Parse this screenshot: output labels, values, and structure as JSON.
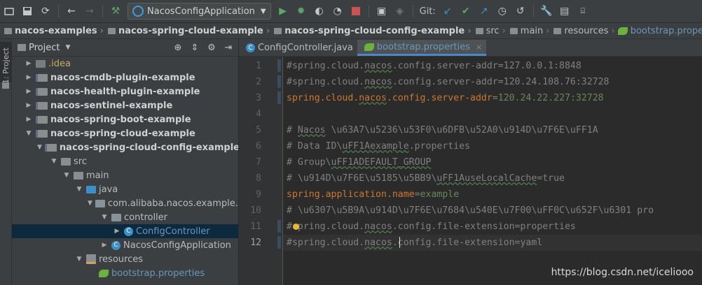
{
  "toolbar": {
    "run_config": "NacosConfigApplication",
    "git_label": "Git:"
  },
  "breadcrumb": [
    {
      "label": "nacos-examples",
      "style": "bold"
    },
    {
      "label": "nacos-spring-cloud-example",
      "style": "bold"
    },
    {
      "label": "nacos-spring-cloud-config-example",
      "style": "bold"
    },
    {
      "label": "src",
      "style": "light"
    },
    {
      "label": "main",
      "style": "light"
    },
    {
      "label": "resources",
      "style": "light"
    },
    {
      "label": "bootstrap.properties",
      "style": "file"
    }
  ],
  "sidebar": {
    "tab_label": "1: Project"
  },
  "project_panel": {
    "title": "Project",
    "tree": [
      {
        "label": ".idea",
        "indent": 1,
        "arrow": "right",
        "icon": "idea",
        "color": "yellow"
      },
      {
        "label": "nacos-cmdb-plugin-example",
        "indent": 1,
        "arrow": "right",
        "icon": "module",
        "color": "bold"
      },
      {
        "label": "nacos-health-plugin-example",
        "indent": 1,
        "arrow": "right",
        "icon": "module",
        "color": "bold"
      },
      {
        "label": "nacos-sentinel-example",
        "indent": 1,
        "arrow": "right",
        "icon": "module",
        "color": "bold"
      },
      {
        "label": "nacos-spring-boot-example",
        "indent": 1,
        "arrow": "right",
        "icon": "module",
        "color": "bold"
      },
      {
        "label": "nacos-spring-cloud-example",
        "indent": 1,
        "arrow": "down",
        "icon": "module",
        "color": "bold"
      },
      {
        "label": "nacos-spring-cloud-config-example",
        "indent": 2,
        "arrow": "down",
        "icon": "module",
        "color": "bold"
      },
      {
        "label": "src",
        "indent": 3,
        "arrow": "down",
        "icon": "folder",
        "color": "normal"
      },
      {
        "label": "main",
        "indent": 4,
        "arrow": "down",
        "icon": "folder",
        "color": "normal"
      },
      {
        "label": "java",
        "indent": 5,
        "arrow": "down",
        "icon": "java",
        "color": "normal"
      },
      {
        "label": "com.alibaba.nacos.example.sp",
        "indent": 6,
        "arrow": "down",
        "icon": "pkg",
        "color": "normal"
      },
      {
        "label": "controller",
        "indent": 7,
        "arrow": "down",
        "icon": "pkg",
        "color": "normal"
      },
      {
        "label": "ConfigController",
        "indent": 8,
        "arrow": "right",
        "icon": "class",
        "color": "blue",
        "selected": true
      },
      {
        "label": "NacosConfigApplication",
        "indent": 7,
        "arrow": "right",
        "icon": "class",
        "color": "normal"
      },
      {
        "label": "resources",
        "indent": 5,
        "arrow": "down",
        "icon": "res",
        "color": "normal"
      },
      {
        "label": "bootstrap.properties",
        "indent": 6,
        "arrow": "none",
        "icon": "leaf",
        "color": "blue"
      }
    ]
  },
  "editor": {
    "tabs": [
      {
        "label": "ConfigController.java",
        "active": false
      },
      {
        "label": "bootstrap.properties",
        "active": true
      }
    ],
    "current_line": 12,
    "lines": [
      {
        "n": "1",
        "parts": [
          {
            "t": "#spring.cloud.",
            "c": "comment"
          },
          {
            "t": "nacos",
            "c": "comment squig"
          },
          {
            "t": ".config.server-addr=127.0.0.1:8848",
            "c": "comment"
          }
        ]
      },
      {
        "n": "2",
        "parts": [
          {
            "t": "#spring.cloud.",
            "c": "comment"
          },
          {
            "t": "nacos",
            "c": "comment squig"
          },
          {
            "t": ".config.server-addr=120.24.108.76:32728",
            "c": "comment"
          }
        ]
      },
      {
        "n": "3",
        "parts": [
          {
            "t": "spring.cloud.",
            "c": "key"
          },
          {
            "t": "nacos",
            "c": "key squig"
          },
          {
            "t": ".config.server-addr",
            "c": "key"
          },
          {
            "t": "=",
            "c": "comment"
          },
          {
            "t": "120.24.22.227:32728",
            "c": "val"
          }
        ]
      },
      {
        "n": "4",
        "parts": []
      },
      {
        "n": "5",
        "parts": [
          {
            "t": "# ",
            "c": "comment"
          },
          {
            "t": "Nacos",
            "c": "comment squig"
          },
          {
            "t": " \\u63A7\\u5236\\u53F0\\u6DFB\\u52A0\\u914D\\u7F6E\\uFF1A",
            "c": "comment"
          }
        ]
      },
      {
        "n": "6",
        "parts": [
          {
            "t": "# Data ID\\",
            "c": "comment"
          },
          {
            "t": "uFF1Aexample",
            "c": "comment squig"
          },
          {
            "t": ".properties",
            "c": "comment"
          }
        ]
      },
      {
        "n": "7",
        "parts": [
          {
            "t": "# Group\\",
            "c": "comment"
          },
          {
            "t": "uFF1ADEFAULT_GROUP",
            "c": "comment squig"
          }
        ]
      },
      {
        "n": "8",
        "parts": [
          {
            "t": "# \\u914D\\u7F6E\\u5185\\u5BB9\\",
            "c": "comment"
          },
          {
            "t": "uFF1AuseLocalCache",
            "c": "comment squig"
          },
          {
            "t": "=true",
            "c": "comment"
          }
        ]
      },
      {
        "n": "9",
        "parts": [
          {
            "t": "spring.application.name",
            "c": "key"
          },
          {
            "t": "=",
            "c": "comment"
          },
          {
            "t": "example",
            "c": "val"
          }
        ]
      },
      {
        "n": "10",
        "parts": [
          {
            "t": "# \\u6307\\u5B9A\\u914D\\u7F6E\\u7684\\u540E\\u7F00\\uFF0C\\u652F\\u6301 pro",
            "c": "comment"
          }
        ]
      },
      {
        "n": "11",
        "parts": [
          {
            "t": "#spring.cloud.",
            "c": "comment"
          },
          {
            "t": "nacos",
            "c": "comment squig"
          },
          {
            "t": ".config.file-extension=properties",
            "c": "comment"
          }
        ]
      },
      {
        "n": "12",
        "parts": [
          {
            "t": "#spring.cloud.",
            "c": "comment"
          },
          {
            "t": "nacos",
            "c": "comment squig"
          },
          {
            "t": ".config.file-extension=yaml",
            "c": "comment"
          }
        ]
      }
    ]
  },
  "watermark": "https://blog.csdn.net/iceliooo",
  "icons": {
    "toolbar": [
      "folder-open-icon",
      "save-icon",
      "sync-icon",
      "back-icon",
      "forward-icon",
      "build-hammer-icon",
      "run-icon",
      "debug-icon",
      "coverage-icon",
      "profile-icon",
      "stop-icon",
      "attach-icon",
      "update-icon",
      "git-update-icon",
      "git-commit-icon",
      "git-push-icon",
      "history-icon",
      "revert-icon",
      "settings-wrench-icon",
      "project-structure-icon",
      "yaml-icon"
    ]
  },
  "colors": {
    "accent": "#4a88c7",
    "property_key": "#cc7832",
    "property_value": "#6a8759",
    "comment": "#808080"
  }
}
